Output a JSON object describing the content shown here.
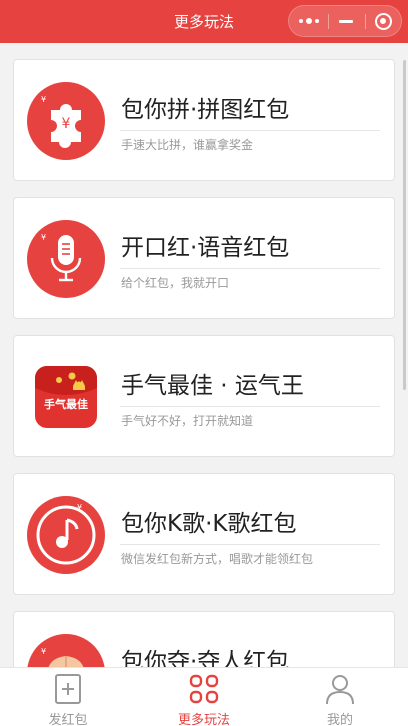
{
  "navbar": {
    "title": "更多玩法"
  },
  "cards": [
    {
      "title": "包你拼·拼图红包",
      "subtitle": "手速大比拼，谁赢拿奖金",
      "icon": "puzzle-icon"
    },
    {
      "title": "开口红·语音红包",
      "subtitle": "给个红包，我就开口",
      "icon": "microphone-icon"
    },
    {
      "title": "手气最佳 · 运气王",
      "subtitle": "手气好不好，打开就知道",
      "icon": "best-luck-icon"
    },
    {
      "title": "包你K歌·K歌红包",
      "subtitle": "微信发红包新方式，唱歌才能领红包",
      "icon": "music-note-icon"
    },
    {
      "title": "包你夺·夺人红包",
      "subtitle": "",
      "icon": "peach-icon"
    }
  ],
  "icon_badge": {
    "yuan": "¥",
    "best_luck_text": "手气最佳"
  },
  "tabbar": {
    "tabs": [
      {
        "label": "发红包",
        "icon": "send-envelope-icon",
        "active": false
      },
      {
        "label": "更多玩法",
        "icon": "grid-icon",
        "active": true
      },
      {
        "label": "我的",
        "icon": "person-icon",
        "active": false
      }
    ]
  },
  "colors": {
    "brand": "#e64340",
    "text": "#222222",
    "subtext": "#999999"
  }
}
